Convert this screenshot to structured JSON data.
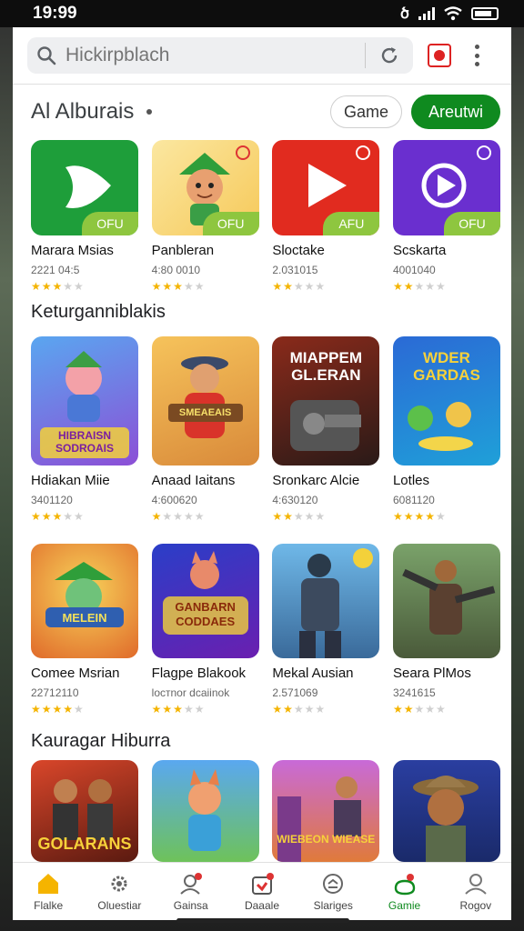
{
  "status_bar": {
    "time": "19:99",
    "extra_icon": "ծ"
  },
  "search": {
    "placeholder": "Hickirpblach"
  },
  "section1": {
    "title": "Al Alburais",
    "filter_label": "Game",
    "action_label": "Areutwi"
  },
  "row1": [
    {
      "name": "Mararа Msias",
      "sub": "2221 04:5",
      "rating": 3,
      "tag": "OFU",
      "icon": "green-arrow-icon"
    },
    {
      "name": "Panbleran",
      "sub": "4:80 0010",
      "rating": 3,
      "tag": "OFU",
      "icon": "cartoon-character-icon"
    },
    {
      "name": "Slоctake",
      "sub": "2.031015",
      "rating": 2,
      "tag": "AFU",
      "icon": "play-button-icon"
    },
    {
      "name": "Scskarta",
      "sub": "4001040",
      "rating": 2,
      "tag": "OFU",
      "icon": "purple-play-icon"
    }
  ],
  "section2": {
    "title": "Keturganniblakis"
  },
  "row2": [
    {
      "name": "Hdiakan Miie",
      "sub": "3401120",
      "rating": 3,
      "art_text": "HIBRAISN SODROAIS",
      "icon": "game-cartoon-icon"
    },
    {
      "name": "Anaad Iaitans",
      "sub": "4:600620",
      "rating": 1,
      "art_text": "SMEAEAIS",
      "icon": "game-adventure-icon"
    },
    {
      "name": "Sronkarc Alcie",
      "sub": "4:630120",
      "rating": 2,
      "art_text": "MIAPPEM GL.ERAN",
      "icon": "game-mech-icon"
    },
    {
      "name": "Lotles",
      "sub": "6081120",
      "rating": 4,
      "art_text": "WDER GARDAS",
      "icon": "game-cards-icon"
    }
  ],
  "row3": [
    {
      "name": "Comee Msrian",
      "sub": "22712110",
      "rating": 4,
      "art_text": "MELEIN",
      "icon": "game-hat-icon"
    },
    {
      "name": "Flagpe Blakook",
      "sub": "lостnor dcaiinok",
      "rating": 3,
      "art_text": "GANBARN CODDAES",
      "icon": "game-fox-icon"
    },
    {
      "name": "Mekal Ausian",
      "sub": "2.571069",
      "rating": 2,
      "art_text": "",
      "icon": "game-soldier-icon"
    },
    {
      "name": "Seara PlMos",
      "sub": "3241615",
      "rating": 2,
      "art_text": "",
      "icon": "game-gunner-icon"
    }
  ],
  "section3": {
    "title": "Kauragar Hiburra"
  },
  "row4": [
    {
      "art_text": "GOLARANS",
      "icon": "game-crew-icon"
    },
    {
      "art_text": "",
      "icon": "game-fox-girl-icon"
    },
    {
      "art_text": "WIEBEON WIEASE",
      "icon": "game-city-icon"
    },
    {
      "art_text": "",
      "icon": "game-explorer-icon"
    }
  ],
  "nav": [
    {
      "label": "Flalke",
      "icon": "home-icon",
      "active": true
    },
    {
      "label": "Oluestiar",
      "icon": "gear-icon",
      "active": false
    },
    {
      "label": "Gainsa",
      "icon": "person-notification-icon",
      "active": false
    },
    {
      "label": "Daaale",
      "icon": "gift-icon",
      "active": false
    },
    {
      "label": "Slariges",
      "icon": "sync-icon",
      "active": false
    },
    {
      "label": "Gamie",
      "icon": "game-icon",
      "active": true
    },
    {
      "label": "Rogov",
      "icon": "profile-icon",
      "active": false
    }
  ],
  "colors": {
    "accent": "#0f8a1f",
    "tag": "#8ec63f",
    "star": "#f4b400"
  }
}
